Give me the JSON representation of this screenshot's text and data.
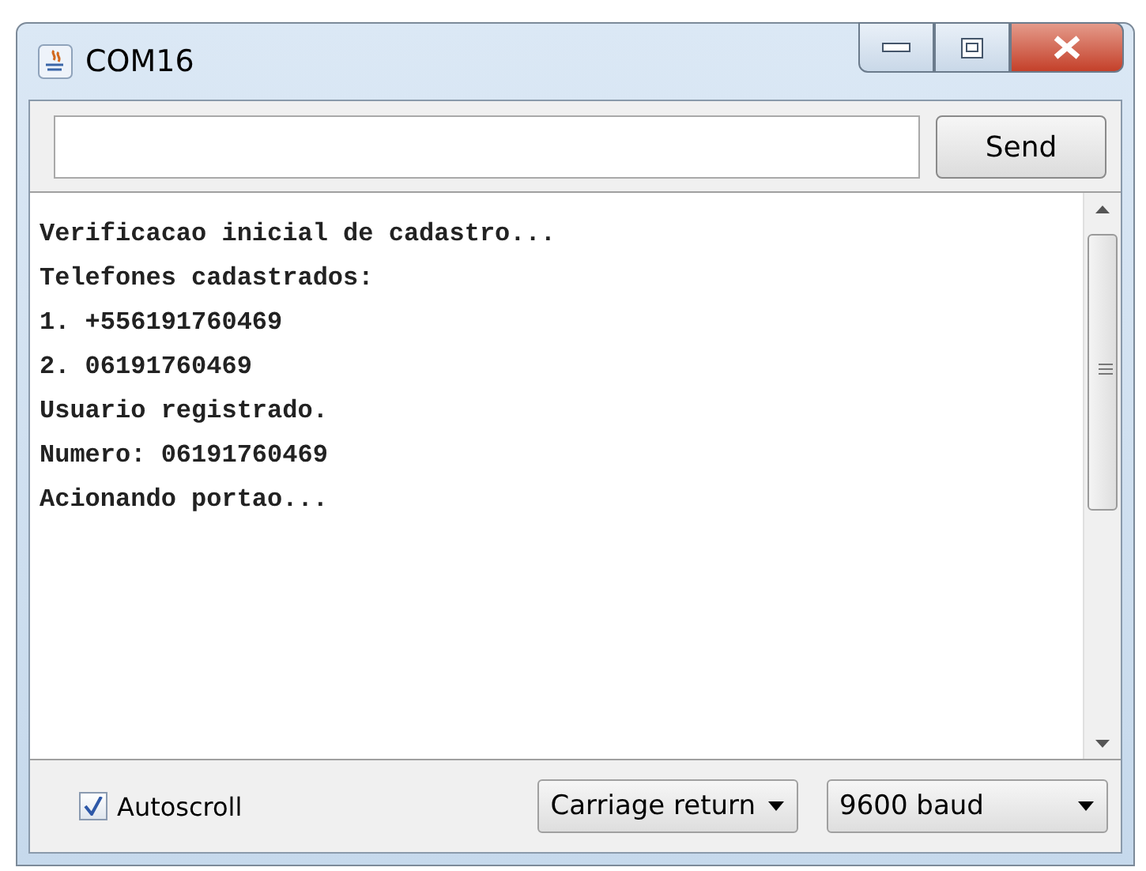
{
  "window": {
    "title": "COM16"
  },
  "send_button": {
    "label": "Send"
  },
  "output": {
    "lines": [
      "Verificacao inicial de cadastro...",
      "Telefones cadastrados:",
      "1. +556191760469",
      "2. 06191760469",
      "Usuario registrado.",
      "Numero: 06191760469",
      "Acionando portao..."
    ]
  },
  "autoscroll": {
    "label": "Autoscroll",
    "checked": true
  },
  "line_ending": {
    "value": "Carriage return"
  },
  "baud_rate": {
    "value": "9600 baud"
  }
}
